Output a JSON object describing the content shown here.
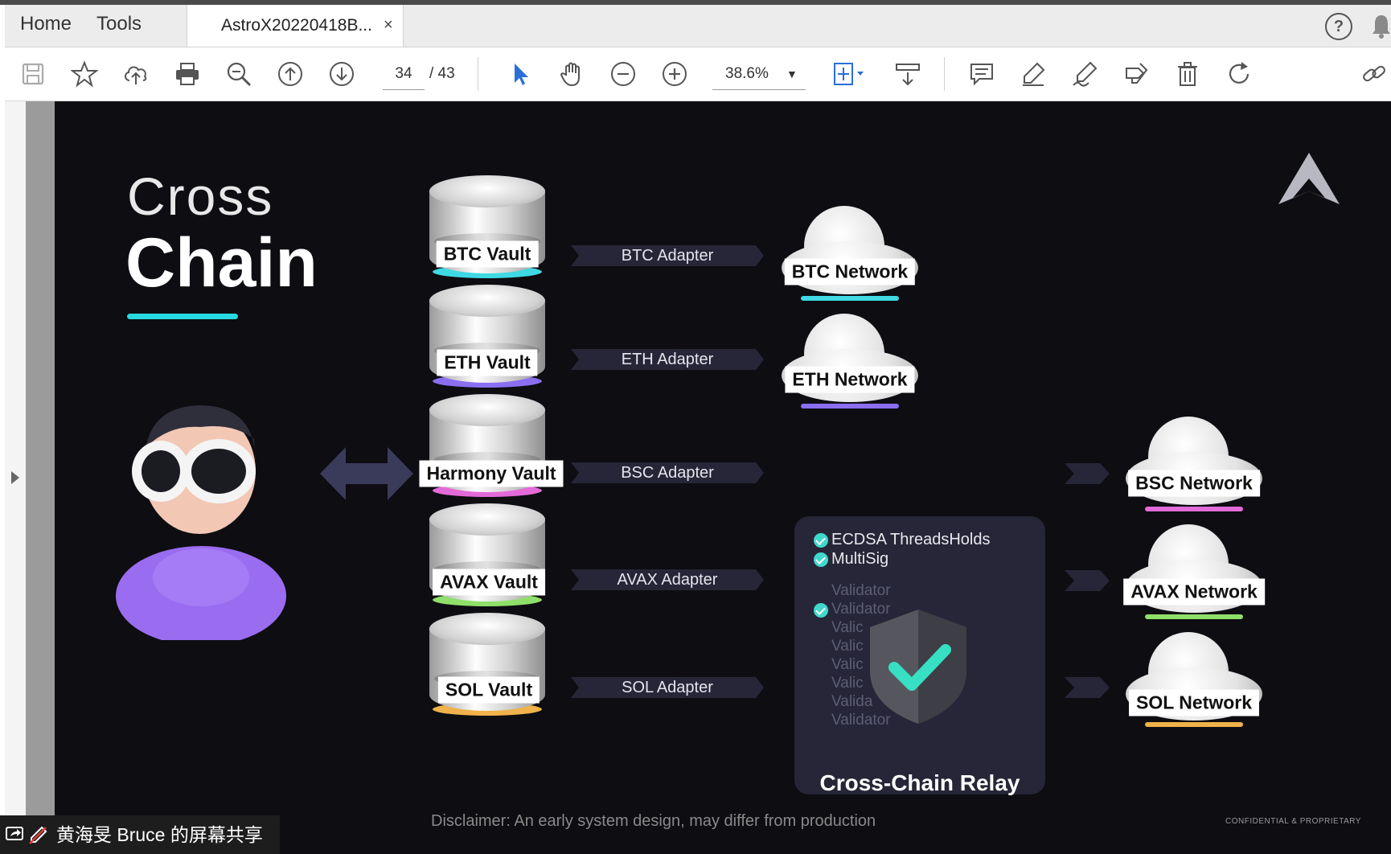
{
  "tabs": {
    "home": "Home",
    "tools": "Tools",
    "document_tab": "AstroX20220418B...",
    "close": "×"
  },
  "help": "?",
  "toolbar": {
    "page_current": "34",
    "page_total": "/ 43",
    "zoom": "38.6%"
  },
  "slide": {
    "title_line1": "Cross",
    "title_line2": "Chain",
    "vaults": [
      {
        "label": "BTC Vault",
        "rim_color": "#3fd9e3"
      },
      {
        "label": "ETH Vault",
        "rim_color": "#8a6ff2"
      },
      {
        "label": "Harmony Vault",
        "rim_color": "#e36ad9"
      },
      {
        "label": "AVAX Vault",
        "rim_color": "#8fe06a"
      },
      {
        "label": "SOL Vault",
        "rim_color": "#f0b24a"
      }
    ],
    "adapters": [
      "BTC Adapter",
      "ETH Adapter",
      "BSC Adapter",
      "AVAX Adapter",
      "SOL Adapter"
    ],
    "networks": [
      {
        "label": "BTC Network",
        "bar_color": "#3fd9e3"
      },
      {
        "label": "ETH Network",
        "bar_color": "#8a6ff2"
      },
      {
        "label": "BSC Network",
        "bar_color": "#e36ad9"
      },
      {
        "label": "AVAX Network",
        "bar_color": "#8fe06a"
      },
      {
        "label": "SOL Network",
        "bar_color": "#f0b24a"
      }
    ],
    "relay": {
      "checks": [
        "ECDSA ThreadsHolds",
        "MultiSig"
      ],
      "validators": [
        "Validator",
        "Validator",
        "Valic",
        "Valic",
        "Valic",
        "Valic",
        "Valida",
        "Validator"
      ],
      "title": "Cross-Chain Relay"
    },
    "disclaimer": "Disclaimer: An early system design, may differ from production",
    "confidential": "CONFIDENTIAL & PROPRIETARY"
  },
  "screen_share": {
    "label": "黄海旻 Bruce 的屏幕共享"
  }
}
